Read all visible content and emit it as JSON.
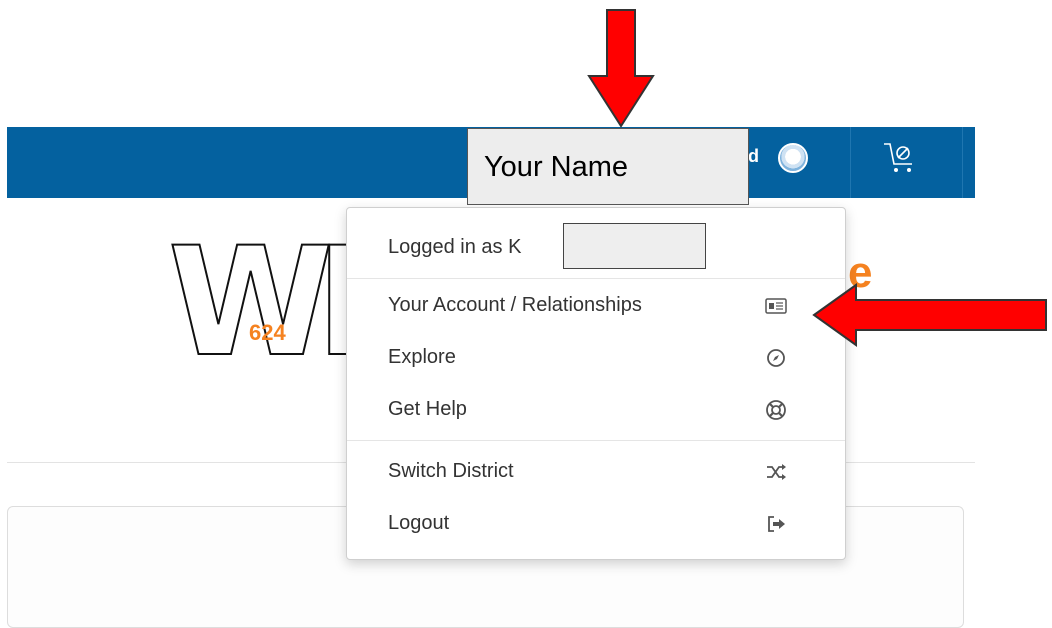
{
  "topbar": {
    "user_label": "d",
    "color": "#04619f",
    "avatar_icon": "user-avatar",
    "cart_icon": "cart-icon"
  },
  "logo": {
    "letters": "WB",
    "number": "624",
    "trailing": "e",
    "accent_color": "#f58220"
  },
  "overlay": {
    "name_box_text": "Your Name"
  },
  "menu": {
    "header": "Logged in as K",
    "items": [
      {
        "label": "Your Account / Relationships",
        "icon": "id-card-icon"
      },
      {
        "label": "Explore",
        "icon": "compass-icon"
      },
      {
        "label": "Get Help",
        "icon": "life-ring-icon"
      },
      {
        "label": "Switch District",
        "icon": "shuffle-icon"
      },
      {
        "label": "Logout",
        "icon": "sign-out-icon"
      }
    ]
  }
}
